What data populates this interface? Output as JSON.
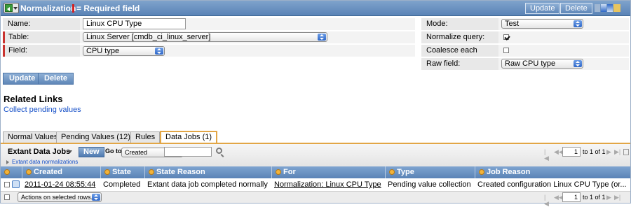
{
  "header": {
    "title": "Normalization",
    "required_legend": "= Required field",
    "update_label": "Update",
    "delete_label": "Delete"
  },
  "form": {
    "name_label": "Name:",
    "name_value": "Linux CPU Type",
    "table_label": "Table:",
    "table_value": "Linux Server [cmdb_ci_linux_server]",
    "field_label": "Field:",
    "field_value": "CPU type",
    "mode_label": "Mode:",
    "mode_value": "Test",
    "normalize_query_label": "Normalize query:",
    "normalize_query_checked": true,
    "coalesce_label": "Coalesce each normal:",
    "coalesce_checked": false,
    "raw_field_label": "Raw field:",
    "raw_field_value": "Raw CPU type"
  },
  "actions": {
    "update_label": "Update",
    "delete_label": "Delete"
  },
  "related": {
    "heading": "Related Links",
    "link": "Collect pending values"
  },
  "tabs": [
    {
      "label": "Normal Values",
      "active": false
    },
    {
      "label": "Pending Values (12)",
      "active": false
    },
    {
      "label": "Rules",
      "active": false
    },
    {
      "label": "Data Jobs (1)",
      "active": true
    }
  ],
  "list": {
    "title": "Extant Data Jobs",
    "new_label": "New",
    "goto_label": "Go to",
    "goto_field": "Created",
    "breadcrumb": "Extant data normalizations",
    "pager_value": "1",
    "pager_text": "to 1 of 1",
    "columns": [
      "Created",
      "State",
      "State Reason",
      "For",
      "Type",
      "Job Reason"
    ],
    "rows": [
      {
        "created": "2011-01-24 08:55:44",
        "state": "Completed",
        "state_reason": "Extant data job completed normally",
        "for": "Normalization: Linux CPU Type",
        "type": "Pending value collection",
        "job_reason": "Created configuration Linux CPU Type (or..."
      }
    ],
    "footer_action": "Actions on selected rows...",
    "footer_pager_value": "1",
    "footer_pager_text": "to 1 of 1"
  }
}
